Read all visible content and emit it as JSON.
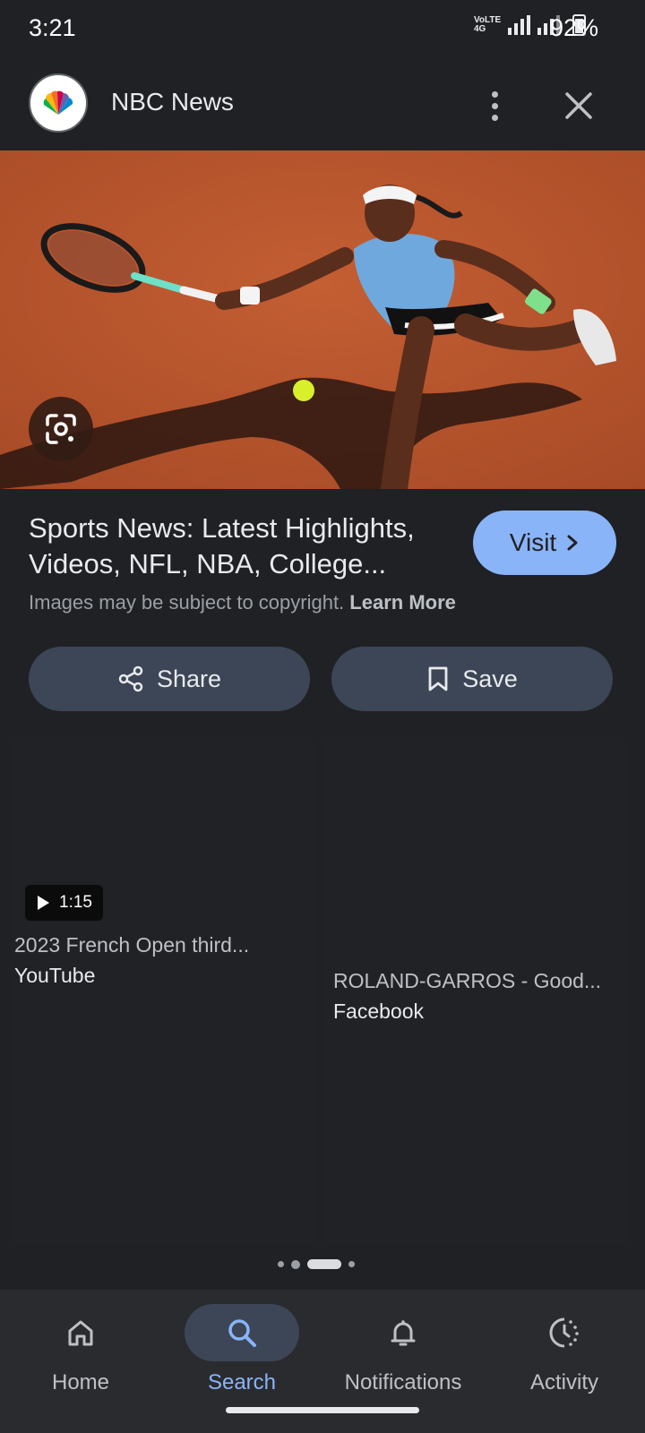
{
  "status_bar": {
    "time": "3:21",
    "network": "VoLTE 4G",
    "battery_percent": "92%"
  },
  "header": {
    "site_name": "NBC News",
    "logo_icon": "nbc-peacock-logo"
  },
  "hero": {
    "description_icon": "google-lens-icon"
  },
  "result": {
    "title": "Sports News: Latest Highlights, Videos, NFL, NBA, College...",
    "visit_label": "Visit",
    "copyright_text": "Images may be subject to copyright.",
    "learn_more_label": "Learn More"
  },
  "actions": {
    "share_label": "Share",
    "save_label": "Save"
  },
  "related": [
    {
      "duration": "1:15",
      "title": "2023 French Open third...",
      "source": "YouTube"
    },
    {
      "title": "ROLAND-GARROS - Good...",
      "source": "Facebook"
    }
  ],
  "pagination": {
    "active_index": 2,
    "count": 4
  },
  "bottom_nav": {
    "items": [
      {
        "label": "Home",
        "icon": "home-icon"
      },
      {
        "label": "Search",
        "icon": "search-icon"
      },
      {
        "label": "Notifications",
        "icon": "bell-icon"
      },
      {
        "label": "Activity",
        "icon": "activity-icon"
      }
    ],
    "active": "Search"
  },
  "colors": {
    "background": "#202124",
    "accent": "#8ab4f8",
    "button": "#3c4656",
    "clay": "#b4522b"
  }
}
